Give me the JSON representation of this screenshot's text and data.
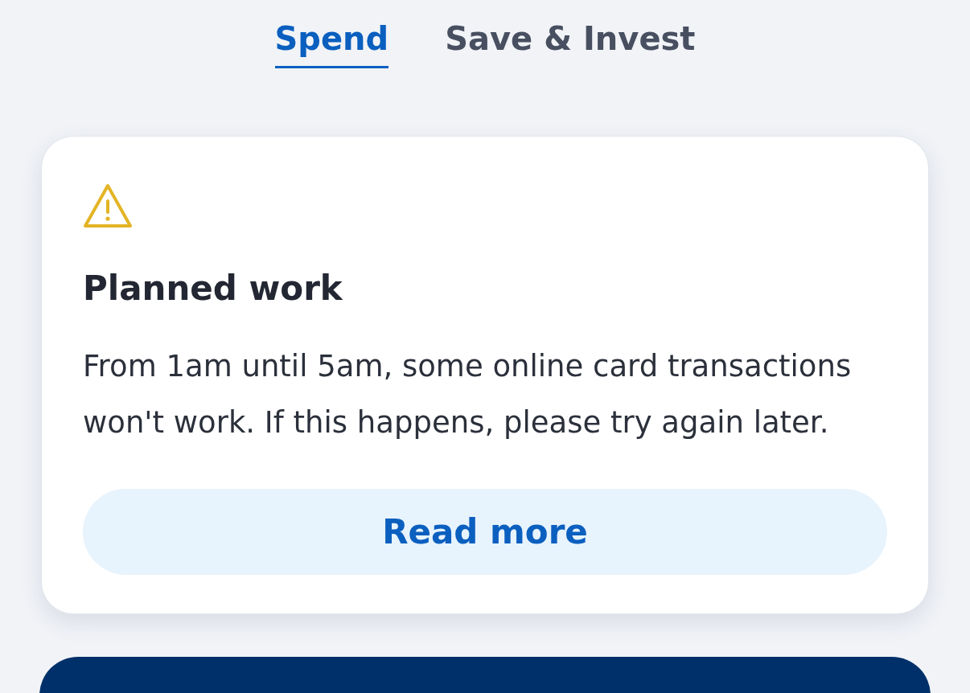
{
  "tabs": [
    {
      "label": "Spend",
      "selected": true
    },
    {
      "label": "Save & Invest",
      "selected": false
    }
  ],
  "notice": {
    "kind": "warning",
    "title": "Planned work",
    "message": "From 1am until 5am, some online card transactions won't work. If this happens, please try again later.",
    "button": "Read more"
  }
}
